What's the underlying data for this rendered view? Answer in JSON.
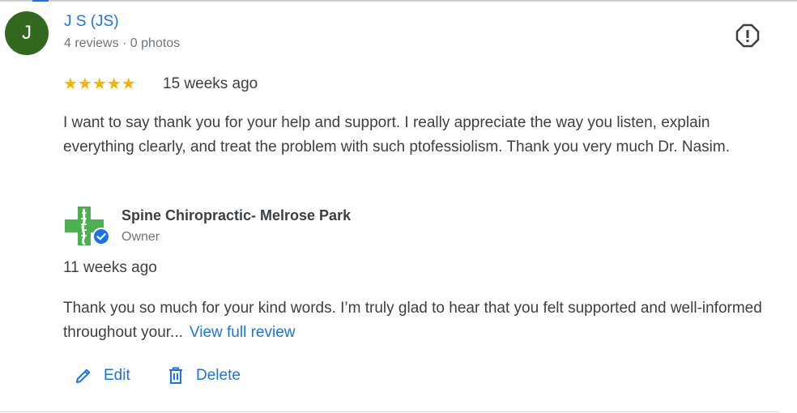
{
  "reviewer": {
    "initial": "J",
    "name": "J S (JS)",
    "meta": "4 reviews · 0 photos",
    "avatar_color": "#33691e"
  },
  "review": {
    "rating": 5,
    "stars": "★★★★★",
    "time": "15 weeks ago",
    "text": "I want to say thank you for your help and support. I really appreciate the way you listen, explain everything clearly, and treat the problem with such ptofessiolism. Thank you very much Dr. Nasim."
  },
  "owner_reply": {
    "business_name": "Spine Chiropractic- Melrose Park",
    "role": "Owner",
    "time": "11 weeks ago",
    "text": "Thank you so much for your kind words. I’m truly glad to hear that you felt supported and well-informed throughout your...",
    "view_full_label": "View full review"
  },
  "actions": {
    "edit_label": "Edit",
    "delete_label": "Delete"
  },
  "icons": {
    "report": "report-flag-icon",
    "edit": "pencil-icon",
    "delete": "trash-icon",
    "verified": "verified-badge-icon"
  },
  "colors": {
    "link": "#1a73e8",
    "star": "#f4b400",
    "logo_green": "#4caf50"
  }
}
